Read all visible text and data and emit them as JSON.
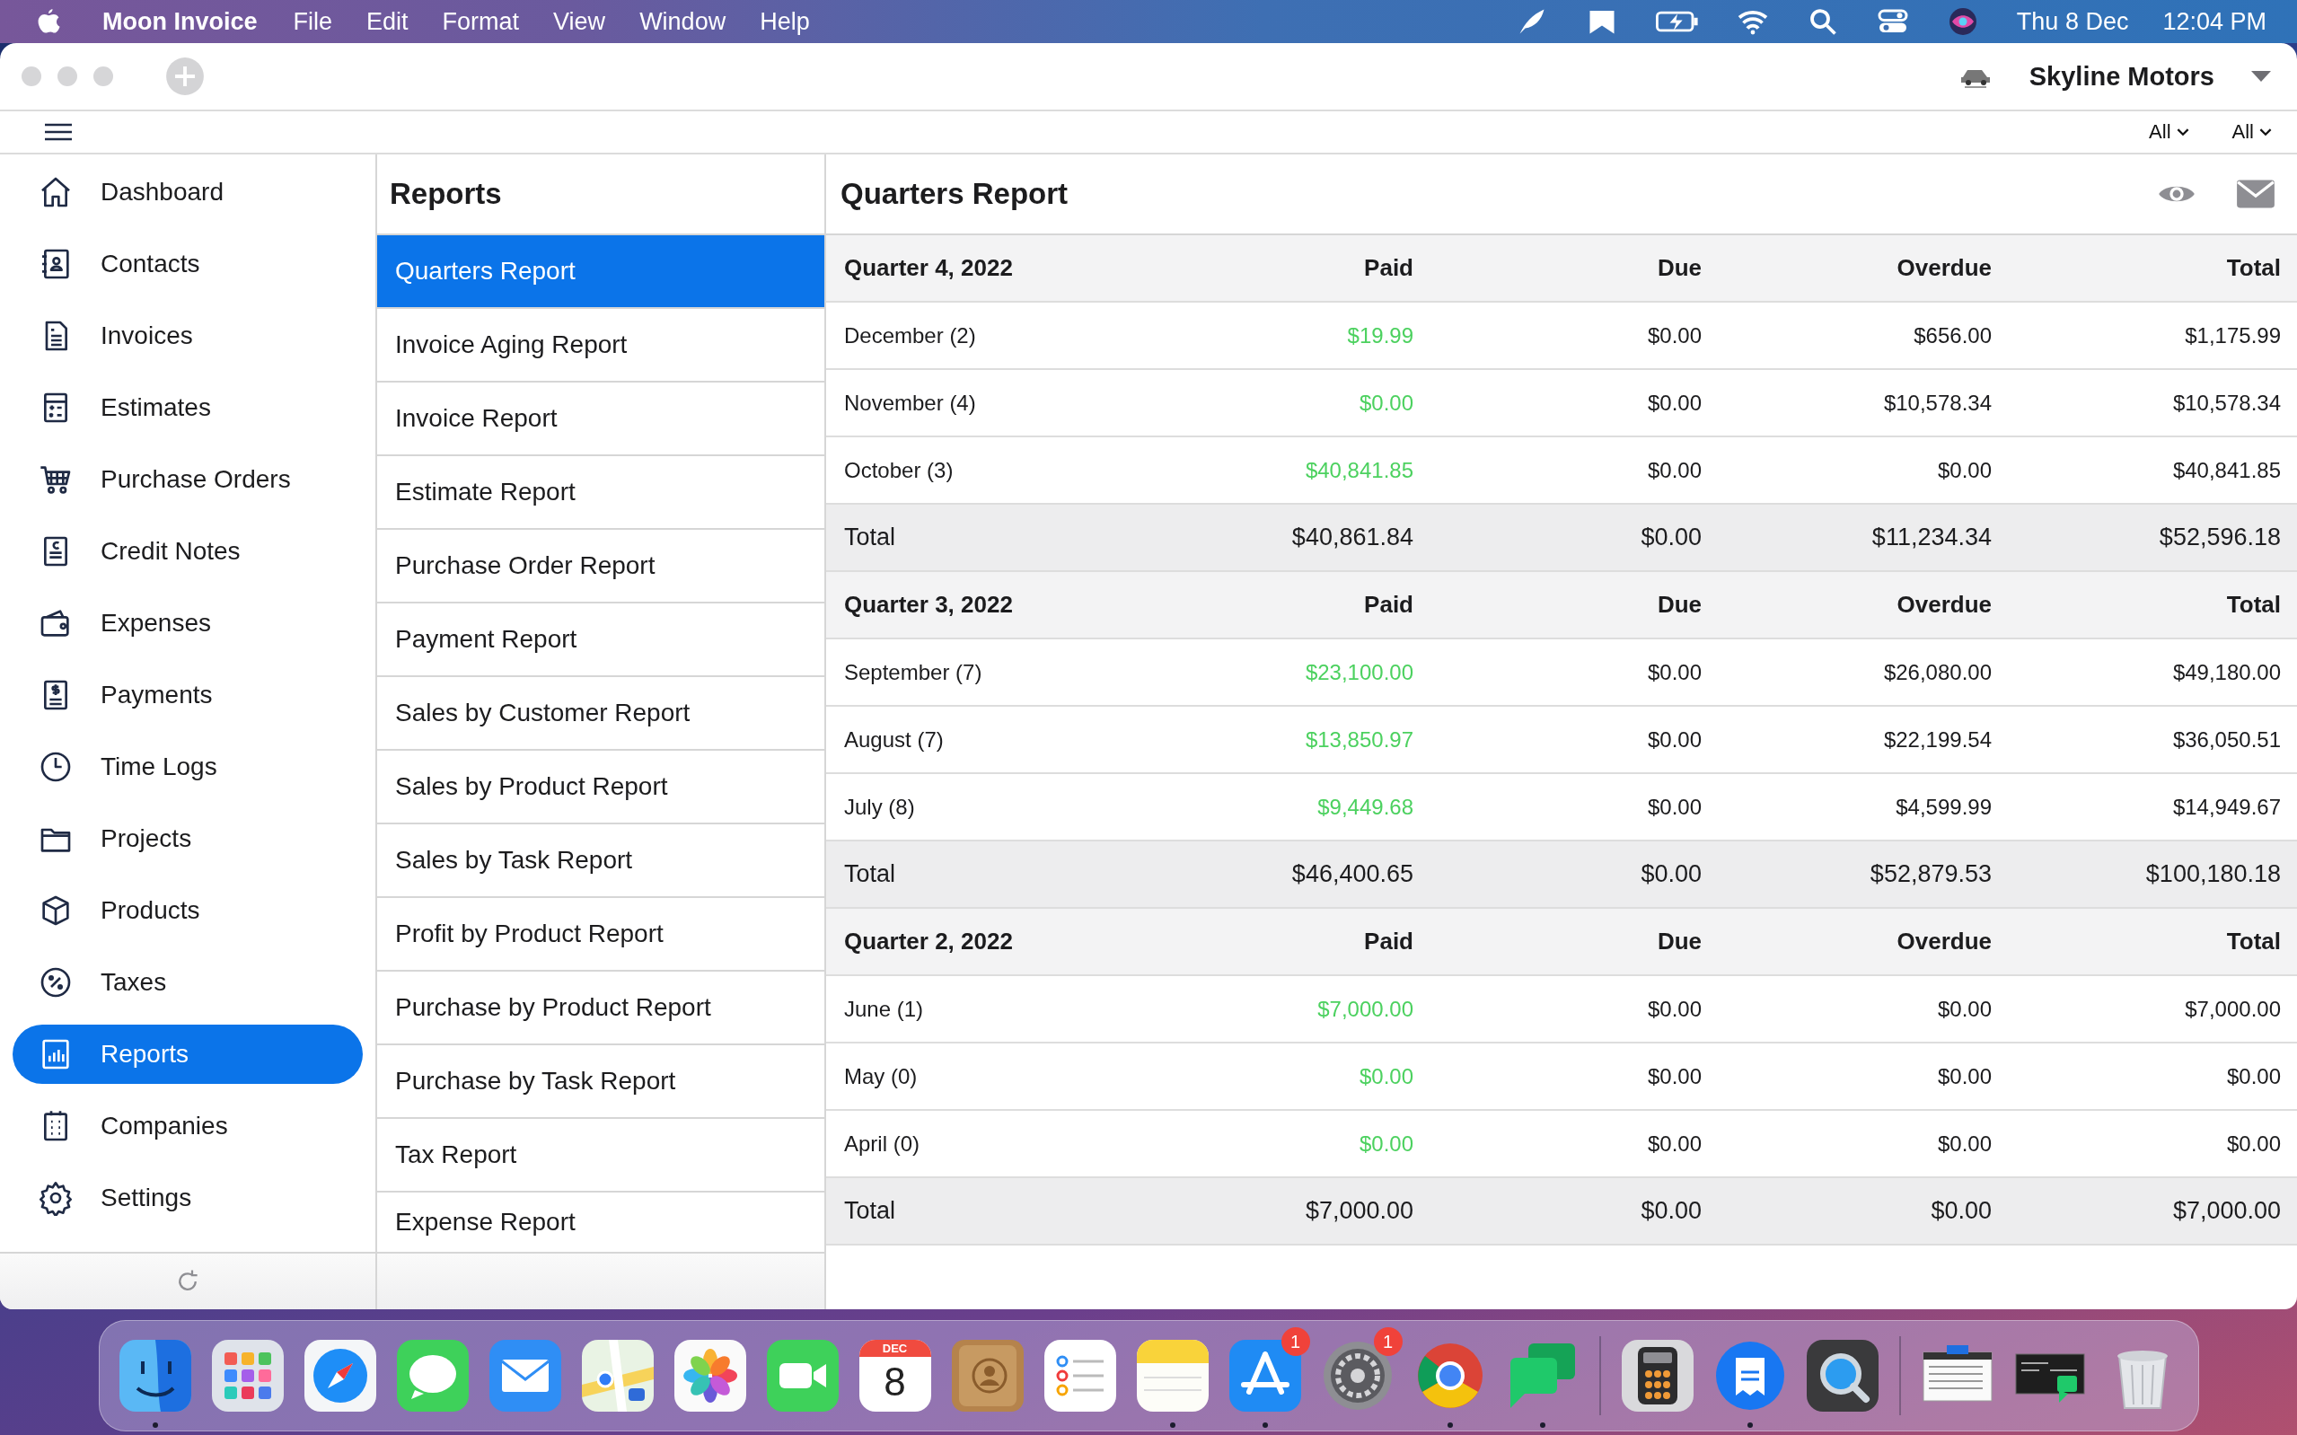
{
  "menubar": {
    "app_name": "Moon Invoice",
    "menus": [
      "File",
      "Edit",
      "Format",
      "View",
      "Window",
      "Help"
    ],
    "date": "Thu 8 Dec",
    "time": "12:04 PM"
  },
  "titlebar": {
    "company": "Skyline Motors"
  },
  "toolbar": {
    "filters": [
      "All",
      "All"
    ]
  },
  "sidebar": {
    "items": [
      {
        "label": "Dashboard",
        "selected": false
      },
      {
        "label": "Contacts",
        "selected": false
      },
      {
        "label": "Invoices",
        "selected": false
      },
      {
        "label": "Estimates",
        "selected": false
      },
      {
        "label": "Purchase Orders",
        "selected": false
      },
      {
        "label": "Credit Notes",
        "selected": false
      },
      {
        "label": "Expenses",
        "selected": false
      },
      {
        "label": "Payments",
        "selected": false
      },
      {
        "label": "Time Logs",
        "selected": false
      },
      {
        "label": "Projects",
        "selected": false
      },
      {
        "label": "Products",
        "selected": false
      },
      {
        "label": "Taxes",
        "selected": false
      },
      {
        "label": "Reports",
        "selected": true
      },
      {
        "label": "Companies",
        "selected": false
      },
      {
        "label": "Settings",
        "selected": false
      }
    ]
  },
  "reports": {
    "title": "Reports",
    "items": [
      {
        "label": "Quarters Report",
        "selected": true
      },
      {
        "label": "Invoice Aging Report",
        "selected": false
      },
      {
        "label": "Invoice Report",
        "selected": false
      },
      {
        "label": "Estimate Report",
        "selected": false
      },
      {
        "label": "Purchase Order Report",
        "selected": false
      },
      {
        "label": "Payment Report",
        "selected": false
      },
      {
        "label": "Sales by Customer Report",
        "selected": false
      },
      {
        "label": "Sales by Product Report",
        "selected": false
      },
      {
        "label": "Sales by Task Report",
        "selected": false
      },
      {
        "label": "Profit by Product Report",
        "selected": false
      },
      {
        "label": "Purchase by Product Report",
        "selected": false
      },
      {
        "label": "Purchase by Task Report",
        "selected": false
      },
      {
        "label": "Tax Report",
        "selected": false
      },
      {
        "label": "Expense Report",
        "selected": false
      }
    ]
  },
  "report": {
    "title": "Quarters Report",
    "sections": [
      {
        "heading": "Quarter 4, 2022",
        "columns": [
          "Paid",
          "Due",
          "Overdue",
          "Total"
        ],
        "rows": [
          {
            "label": "December (2)",
            "values": [
              "$19.99",
              "$0.00",
              "$656.00",
              "$1,175.99"
            ]
          },
          {
            "label": "November (4)",
            "values": [
              "$0.00",
              "$0.00",
              "$10,578.34",
              "$10,578.34"
            ]
          },
          {
            "label": "October (3)",
            "values": [
              "$40,841.85",
              "$0.00",
              "$0.00",
              "$40,841.85"
            ]
          }
        ],
        "total": {
          "label": "Total",
          "values": [
            "$40,861.84",
            "$0.00",
            "$11,234.34",
            "$52,596.18"
          ]
        }
      },
      {
        "heading": "Quarter 3, 2022",
        "columns": [
          "Paid",
          "Due",
          "Overdue",
          "Total"
        ],
        "rows": [
          {
            "label": "September (7)",
            "values": [
              "$23,100.00",
              "$0.00",
              "$26,080.00",
              "$49,180.00"
            ]
          },
          {
            "label": "August (7)",
            "values": [
              "$13,850.97",
              "$0.00",
              "$22,199.54",
              "$36,050.51"
            ]
          },
          {
            "label": "July (8)",
            "values": [
              "$9,449.68",
              "$0.00",
              "$4,599.99",
              "$14,949.67"
            ]
          }
        ],
        "total": {
          "label": "Total",
          "values": [
            "$46,400.65",
            "$0.00",
            "$52,879.53",
            "$100,180.18"
          ]
        }
      },
      {
        "heading": "Quarter 2, 2022",
        "columns": [
          "Paid",
          "Due",
          "Overdue",
          "Total"
        ],
        "rows": [
          {
            "label": "June (1)",
            "values": [
              "$7,000.00",
              "$0.00",
              "$0.00",
              "$7,000.00"
            ]
          },
          {
            "label": "May (0)",
            "values": [
              "$0.00",
              "$0.00",
              "$0.00",
              "$0.00"
            ]
          },
          {
            "label": "April (0)",
            "values": [
              "$0.00",
              "$0.00",
              "$0.00",
              "$0.00"
            ]
          }
        ],
        "total": {
          "label": "Total",
          "values": [
            "$7,000.00",
            "$0.00",
            "$0.00",
            "$7,000.00"
          ]
        }
      }
    ]
  },
  "dock": {
    "groups": [
      [
        {
          "kind": "app",
          "running": true
        },
        {
          "kind": "app",
          "running": false
        },
        {
          "kind": "app",
          "running": false
        },
        {
          "kind": "app",
          "running": false
        },
        {
          "kind": "app",
          "running": false
        },
        {
          "kind": "app",
          "running": false
        },
        {
          "kind": "app",
          "running": false
        },
        {
          "kind": "app",
          "running": false
        },
        {
          "kind": "calendar",
          "month": "DEC",
          "day": "8",
          "running": false
        },
        {
          "kind": "app",
          "running": false
        },
        {
          "kind": "app",
          "running": false
        },
        {
          "kind": "app",
          "running": true
        },
        {
          "kind": "app",
          "running": true,
          "badge": "1"
        },
        {
          "kind": "app",
          "running": false,
          "badge": "1"
        },
        {
          "kind": "app",
          "running": true
        },
        {
          "kind": "app",
          "running": true
        }
      ],
      [
        {
          "kind": "app",
          "running": false
        },
        {
          "kind": "app",
          "running": true
        },
        {
          "kind": "app",
          "running": false
        }
      ],
      [
        {
          "kind": "window",
          "running": false
        },
        {
          "kind": "window",
          "running": false
        },
        {
          "kind": "app",
          "running": false
        }
      ]
    ]
  }
}
